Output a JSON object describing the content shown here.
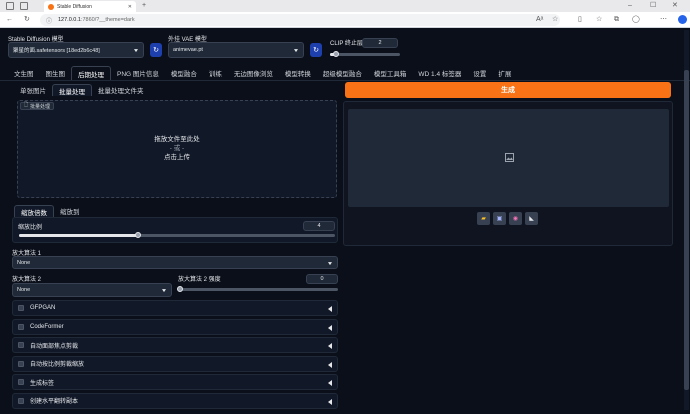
{
  "browser": {
    "tab_title": "Stable Diffusion",
    "url_host": "127.0.0.1",
    "url_rest": ":7860/?__theme=dark"
  },
  "top": {
    "sd_model_label": "Stable Diffusion 模型",
    "sd_model_value": "聚星的面.safetensors [18ed2b6c48]",
    "vae_label": "外挂 VAE 模型",
    "vae_value": "animevae.pt",
    "clip_label": "CLIP 终止层数",
    "clip_value": "2",
    "clip_fraction": 0.09
  },
  "main_tabs": [
    "文生图",
    "图生图",
    "后期处理",
    "PNG 图片信息",
    "模型融合",
    "训练",
    "无边图像浏览",
    "模型转换",
    "超级模型融合",
    "模型工具箱",
    "WD 1.4 标签器",
    "设置",
    "扩展"
  ],
  "active_main_tab": "后期处理",
  "sub_tabs": [
    "单张图片",
    "批量处理",
    "批量处理文件夹"
  ],
  "active_sub_tab": "批量处理",
  "upload": {
    "badge": "批量处理",
    "line1": "拖放文件至此处",
    "line2": "- 或 -",
    "line3": "点击上传"
  },
  "scale_tabs": [
    "缩放倍数",
    "缩放到"
  ],
  "resize": {
    "label": "缩放比例",
    "value": "4",
    "fraction": 0.375
  },
  "upscaler1": {
    "label": "放大算法 1",
    "value": "None"
  },
  "upscaler2": {
    "label": "放大算法 2",
    "value": "None"
  },
  "upscaler2_vis": {
    "label": "放大算法 2 强度",
    "value": "0",
    "fraction": 0.0
  },
  "accordions": [
    "GFPGAN",
    "CodeFormer",
    "自动面部焦点剪裁",
    "自动按比例剪裁缩放",
    "生成标签",
    "创建水平翻转副本"
  ],
  "generate_button": "生成",
  "colors": {
    "accent": "#f97316",
    "bg": "#0b0f19",
    "panel": "#111827"
  },
  "tool_icons": [
    "folder-icon",
    "image-icon",
    "palette-icon",
    "ruler-icon"
  ]
}
